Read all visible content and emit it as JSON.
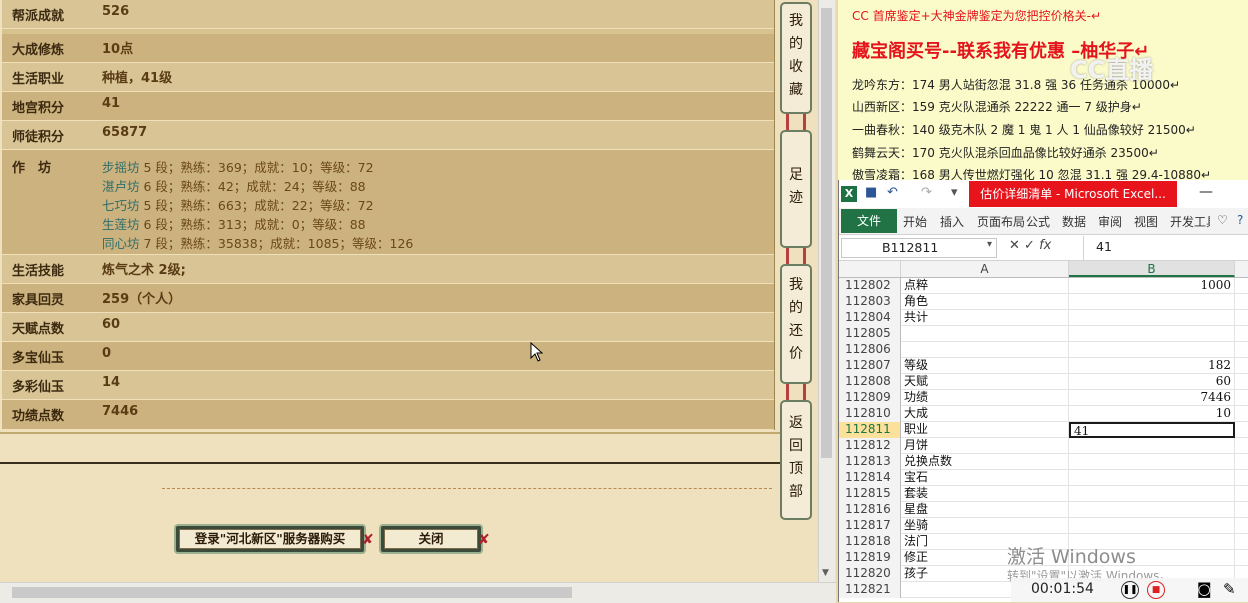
{
  "game": {
    "stats": [
      {
        "label": "帮派成就",
        "value": "526"
      },
      {
        "label": "大成修炼",
        "value": "10点"
      },
      {
        "label": "生活职业",
        "value": "种植，41级"
      },
      {
        "label": "地宫积分",
        "value": "41"
      },
      {
        "label": "师徒积分",
        "value": "65877"
      }
    ],
    "workshop_label": "作　坊",
    "workshops": [
      {
        "name": "步摇坊",
        "text": " 5 段；熟练：369；成就：10；等级：72"
      },
      {
        "name": "湛卢坊",
        "text": " 6 段；熟练：42；成就：24；等级：88"
      },
      {
        "name": "七巧坊",
        "text": " 5 段；熟练：663；成就：22；等级：72"
      },
      {
        "name": "生莲坊",
        "text": " 6 段；熟练：313；成就：0；等级：88"
      },
      {
        "name": "同心坊",
        "text": " 7 段；熟练：35838；成就：1085；等级：126"
      }
    ],
    "stats2": [
      {
        "label": "生活技能",
        "value": "炼气之术 2级;"
      },
      {
        "label": "家具回灵",
        "value": "259（个人）"
      },
      {
        "label": "天赋点数",
        "value": "60"
      },
      {
        "label": "多宝仙玉",
        "value": "0"
      },
      {
        "label": "多彩仙玉",
        "value": "14"
      },
      {
        "label": "功绩点数",
        "value": "7446"
      }
    ],
    "login_button": "登录\"河北新区\"服务器购买",
    "close_button": "关闭",
    "tabs": [
      {
        "chars": [
          "我",
          "的",
          "收",
          "藏"
        ]
      },
      {
        "chars": [
          "足",
          "迹"
        ]
      },
      {
        "chars": [
          "我",
          "的",
          "还",
          "价"
        ]
      },
      {
        "chars": [
          "返",
          "回",
          "顶",
          "部"
        ]
      }
    ]
  },
  "ad": {
    "line1": "CC 首席鉴定+大神金牌鉴定为您把控价格关-↵",
    "line2": "藏宝阁买号--联系我有优惠 –柚华子↵",
    "lines": [
      "龙吟东方：174 男人站街忽混 31.8 强 36 任务通杀 10000↵",
      "山西新区：159 克火队混通杀 22222 通一 7 级护身↵",
      "一曲春秋：140 级克木队 2 魔 1 鬼 1 人 1 仙品像较好 21500↵",
      "鹤舞云天：170 克火队混杀回血品像比较好通杀 23500↵",
      "傲雪凌霜：168 男人传世燃灯强化 10 忽混 31.1 强 29.4-10880↵"
    ],
    "watermark": "CC直播"
  },
  "excel": {
    "title": "估价详细清单 - Microsoft Excel...",
    "minimize": "—",
    "ribbon_file": "文件",
    "ribbon_tabs": [
      "开始",
      "插入",
      "页面布局",
      "公式",
      "数据",
      "审阅",
      "视图",
      "开发工具"
    ],
    "name_box": "B112811",
    "formula_value": "41",
    "col_a": "A",
    "col_b": "B",
    "rows": [
      {
        "num": "112802",
        "a": "点粹",
        "b": "1000"
      },
      {
        "num": "112803",
        "a": "角色",
        "b": ""
      },
      {
        "num": "112804",
        "a": "共计",
        "b": ""
      },
      {
        "num": "112805",
        "a": "",
        "b": ""
      },
      {
        "num": "112806",
        "a": "",
        "b": ""
      },
      {
        "num": "112807",
        "a": "等级",
        "b": "182"
      },
      {
        "num": "112808",
        "a": "天赋",
        "b": "60"
      },
      {
        "num": "112809",
        "a": "功绩",
        "b": "7446"
      },
      {
        "num": "112810",
        "a": "大成",
        "b": "10"
      },
      {
        "num": "112811",
        "a": "职业",
        "b": "41"
      },
      {
        "num": "112812",
        "a": "月饼",
        "b": ""
      },
      {
        "num": "112813",
        "a": "兑换点数",
        "b": ""
      },
      {
        "num": "112814",
        "a": "宝石",
        "b": ""
      },
      {
        "num": "112815",
        "a": "套装",
        "b": ""
      },
      {
        "num": "112816",
        "a": "星盘",
        "b": ""
      },
      {
        "num": "112817",
        "a": "坐骑",
        "b": ""
      },
      {
        "num": "112818",
        "a": "法门",
        "b": ""
      },
      {
        "num": "112819",
        "a": "修正",
        "b": ""
      },
      {
        "num": "112820",
        "a": "孩子",
        "b": ""
      },
      {
        "num": "112821",
        "a": "",
        "b": ""
      }
    ],
    "selected_row": "112811",
    "activate_title": "激活 Windows",
    "activate_sub": "转到\"设置\"以激活 Windows。"
  },
  "recorder": {
    "time": "00:01:54"
  }
}
